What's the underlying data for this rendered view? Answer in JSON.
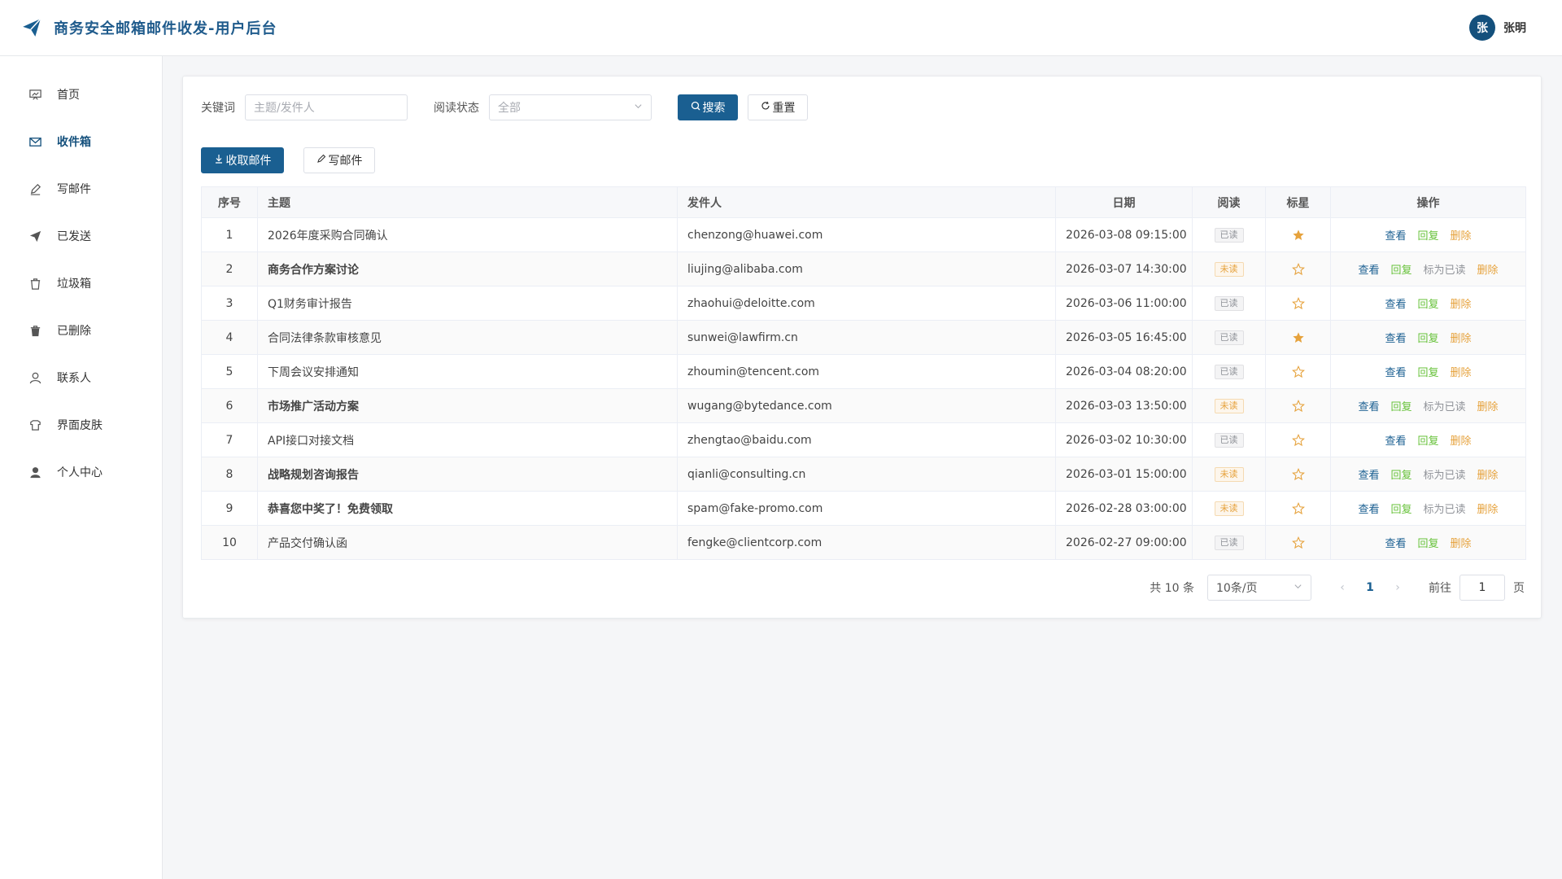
{
  "header": {
    "title": "商务安全邮箱邮件收发-用户后台",
    "user_avatar": "张",
    "user_name": "张明"
  },
  "sidebar": {
    "items": [
      {
        "label": "首页",
        "icon": "dashboard-icon",
        "active": false
      },
      {
        "label": "收件箱",
        "icon": "inbox-icon",
        "active": true
      },
      {
        "label": "写邮件",
        "icon": "pen-icon",
        "active": false
      },
      {
        "label": "已发送",
        "icon": "send-icon",
        "active": false
      },
      {
        "label": "垃圾箱",
        "icon": "trash-icon",
        "active": false
      },
      {
        "label": "已删除",
        "icon": "deleted-icon",
        "active": false
      },
      {
        "label": "联系人",
        "icon": "contact-icon",
        "active": false
      },
      {
        "label": "界面皮肤",
        "icon": "skin-icon",
        "active": false
      },
      {
        "label": "个人中心",
        "icon": "user-icon",
        "active": false
      }
    ]
  },
  "filters": {
    "keyword_label": "关键词",
    "keyword_placeholder": "主题/发件人",
    "status_label": "阅读状态",
    "status_value": "全部",
    "search_label": "搜索",
    "reset_label": "重置"
  },
  "actions": {
    "fetch_label": "收取邮件",
    "compose_label": "写邮件"
  },
  "table": {
    "headers": {
      "index": "序号",
      "subject": "主题",
      "sender": "发件人",
      "date": "日期",
      "read": "阅读",
      "star": "标星",
      "ops": "操作"
    },
    "op_labels": {
      "view": "查看",
      "reply": "回复",
      "mark": "标为已读",
      "delete": "删除"
    },
    "rows": [
      {
        "index": "1",
        "subject": "2026年度采购合同确认",
        "sender": "chenzong@huawei.com",
        "date": "2026-03-08 09:15:00",
        "read_status": "已读",
        "read": true,
        "starred": true
      },
      {
        "index": "2",
        "subject": "商务合作方案讨论",
        "sender": "liujing@alibaba.com",
        "date": "2026-03-07 14:30:00",
        "read_status": "未读",
        "read": false,
        "starred": false
      },
      {
        "index": "3",
        "subject": "Q1财务审计报告",
        "sender": "zhaohui@deloitte.com",
        "date": "2026-03-06 11:00:00",
        "read_status": "已读",
        "read": true,
        "starred": false
      },
      {
        "index": "4",
        "subject": "合同法律条款审核意见",
        "sender": "sunwei@lawfirm.cn",
        "date": "2026-03-05 16:45:00",
        "read_status": "已读",
        "read": true,
        "starred": true
      },
      {
        "index": "5",
        "subject": "下周会议安排通知",
        "sender": "zhoumin@tencent.com",
        "date": "2026-03-04 08:20:00",
        "read_status": "已读",
        "read": true,
        "starred": false
      },
      {
        "index": "6",
        "subject": "市场推广活动方案",
        "sender": "wugang@bytedance.com",
        "date": "2026-03-03 13:50:00",
        "read_status": "未读",
        "read": false,
        "starred": false
      },
      {
        "index": "7",
        "subject": "API接口对接文档",
        "sender": "zhengtao@baidu.com",
        "date": "2026-03-02 10:30:00",
        "read_status": "已读",
        "read": true,
        "starred": false
      },
      {
        "index": "8",
        "subject": "战略规划咨询报告",
        "sender": "qianli@consulting.cn",
        "date": "2026-03-01 15:00:00",
        "read_status": "未读",
        "read": false,
        "starred": false
      },
      {
        "index": "9",
        "subject": "恭喜您中奖了！免费领取",
        "sender": "spam@fake-promo.com",
        "date": "2026-02-28 03:00:00",
        "read_status": "未读",
        "read": false,
        "starred": false
      },
      {
        "index": "10",
        "subject": "产品交付确认函",
        "sender": "fengke@clientcorp.com",
        "date": "2026-02-27 09:00:00",
        "read_status": "已读",
        "read": true,
        "starred": false
      }
    ]
  },
  "pagination": {
    "total_text": "共 10 条",
    "page_size": "10条/页",
    "current_page": "1",
    "goto_label": "前往",
    "goto_value": "1",
    "page_suffix": "页"
  },
  "colors": {
    "primary": "#1a5f91",
    "star": "#e6a23c",
    "reply": "#67c23a",
    "delete": "#e6a23c"
  }
}
